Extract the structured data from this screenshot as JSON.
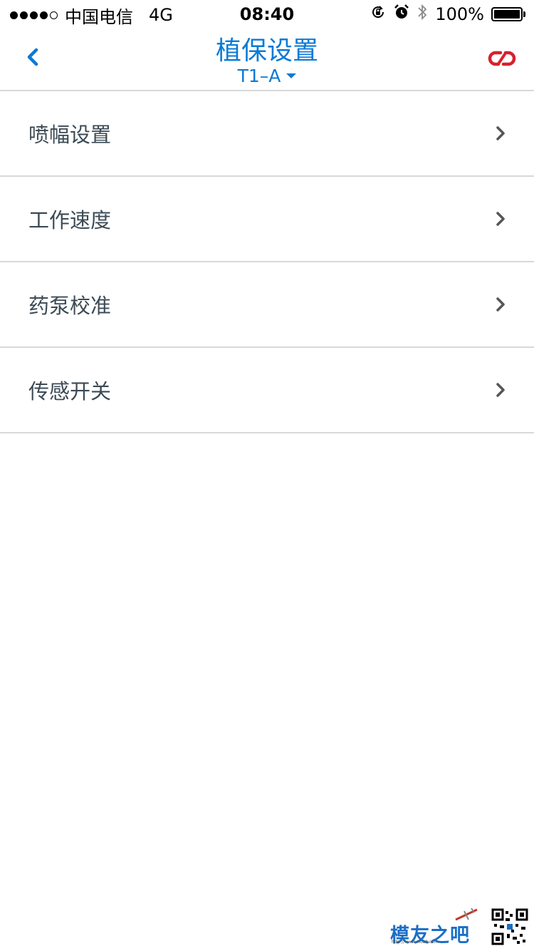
{
  "status_bar": {
    "carrier": "中国电信",
    "network": "4G",
    "time": "08:40",
    "battery": "100%",
    "icons": [
      "rotation-lock-icon",
      "alarm-icon",
      "bluetooth-icon",
      "battery-icon"
    ]
  },
  "nav": {
    "title": "植保设置",
    "device": "T1–A",
    "back_icon": "chevron-left-icon",
    "link_icon": "broken-link-icon"
  },
  "menu": {
    "items": [
      {
        "label": "喷幅设置"
      },
      {
        "label": "工作速度"
      },
      {
        "label": "药泵校准"
      },
      {
        "label": "传感开关"
      }
    ]
  },
  "watermark": {
    "text": "模友之吧",
    "url": "http://www.moz8.com"
  },
  "colors": {
    "accent": "#0a7ad6",
    "disconnect": "#d9202e",
    "label": "#3c4a55",
    "divider": "#d9d9d9"
  }
}
